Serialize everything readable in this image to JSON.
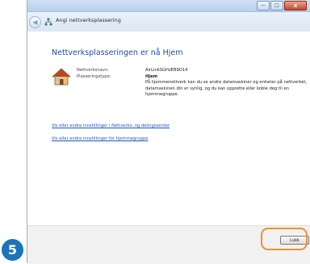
{
  "window": {
    "title": "Angi nettverksplassering",
    "controls": {
      "minimize": "—",
      "maximize": "□",
      "close": "x"
    }
  },
  "heading": "Nettverksplasseringen er nå Hjem",
  "info": {
    "network_name_label": "Nettverksnavn:",
    "network_name_value": "AirLinkSGHzEB9D14",
    "location_type_label": "Plasseringstype:",
    "location_type_value": "Hjem",
    "description": "På hjemmenettverk kan du se andre datamaskiner og enheter på nettverket, datamaskinen din er synlig, og du kan opprette eller koble deg til en hjemmegruppe."
  },
  "links": {
    "network_center": "Vis eller endre innstillinger i Nettverks- og delingssenter",
    "homegroup": "Vis eller endre innstillinger for hjemmegruppe"
  },
  "footer": {
    "close_label": "Lukk"
  },
  "step": {
    "number": "5"
  },
  "colors": {
    "accent_blue": "#1a4e9c",
    "link_blue": "#1f55c7",
    "highlight_orange": "#f0922d",
    "badge_blue": "#1b73ba"
  },
  "icons": {
    "back": "back-arrow-icon",
    "network": "network-icon",
    "house": "home-icon"
  }
}
